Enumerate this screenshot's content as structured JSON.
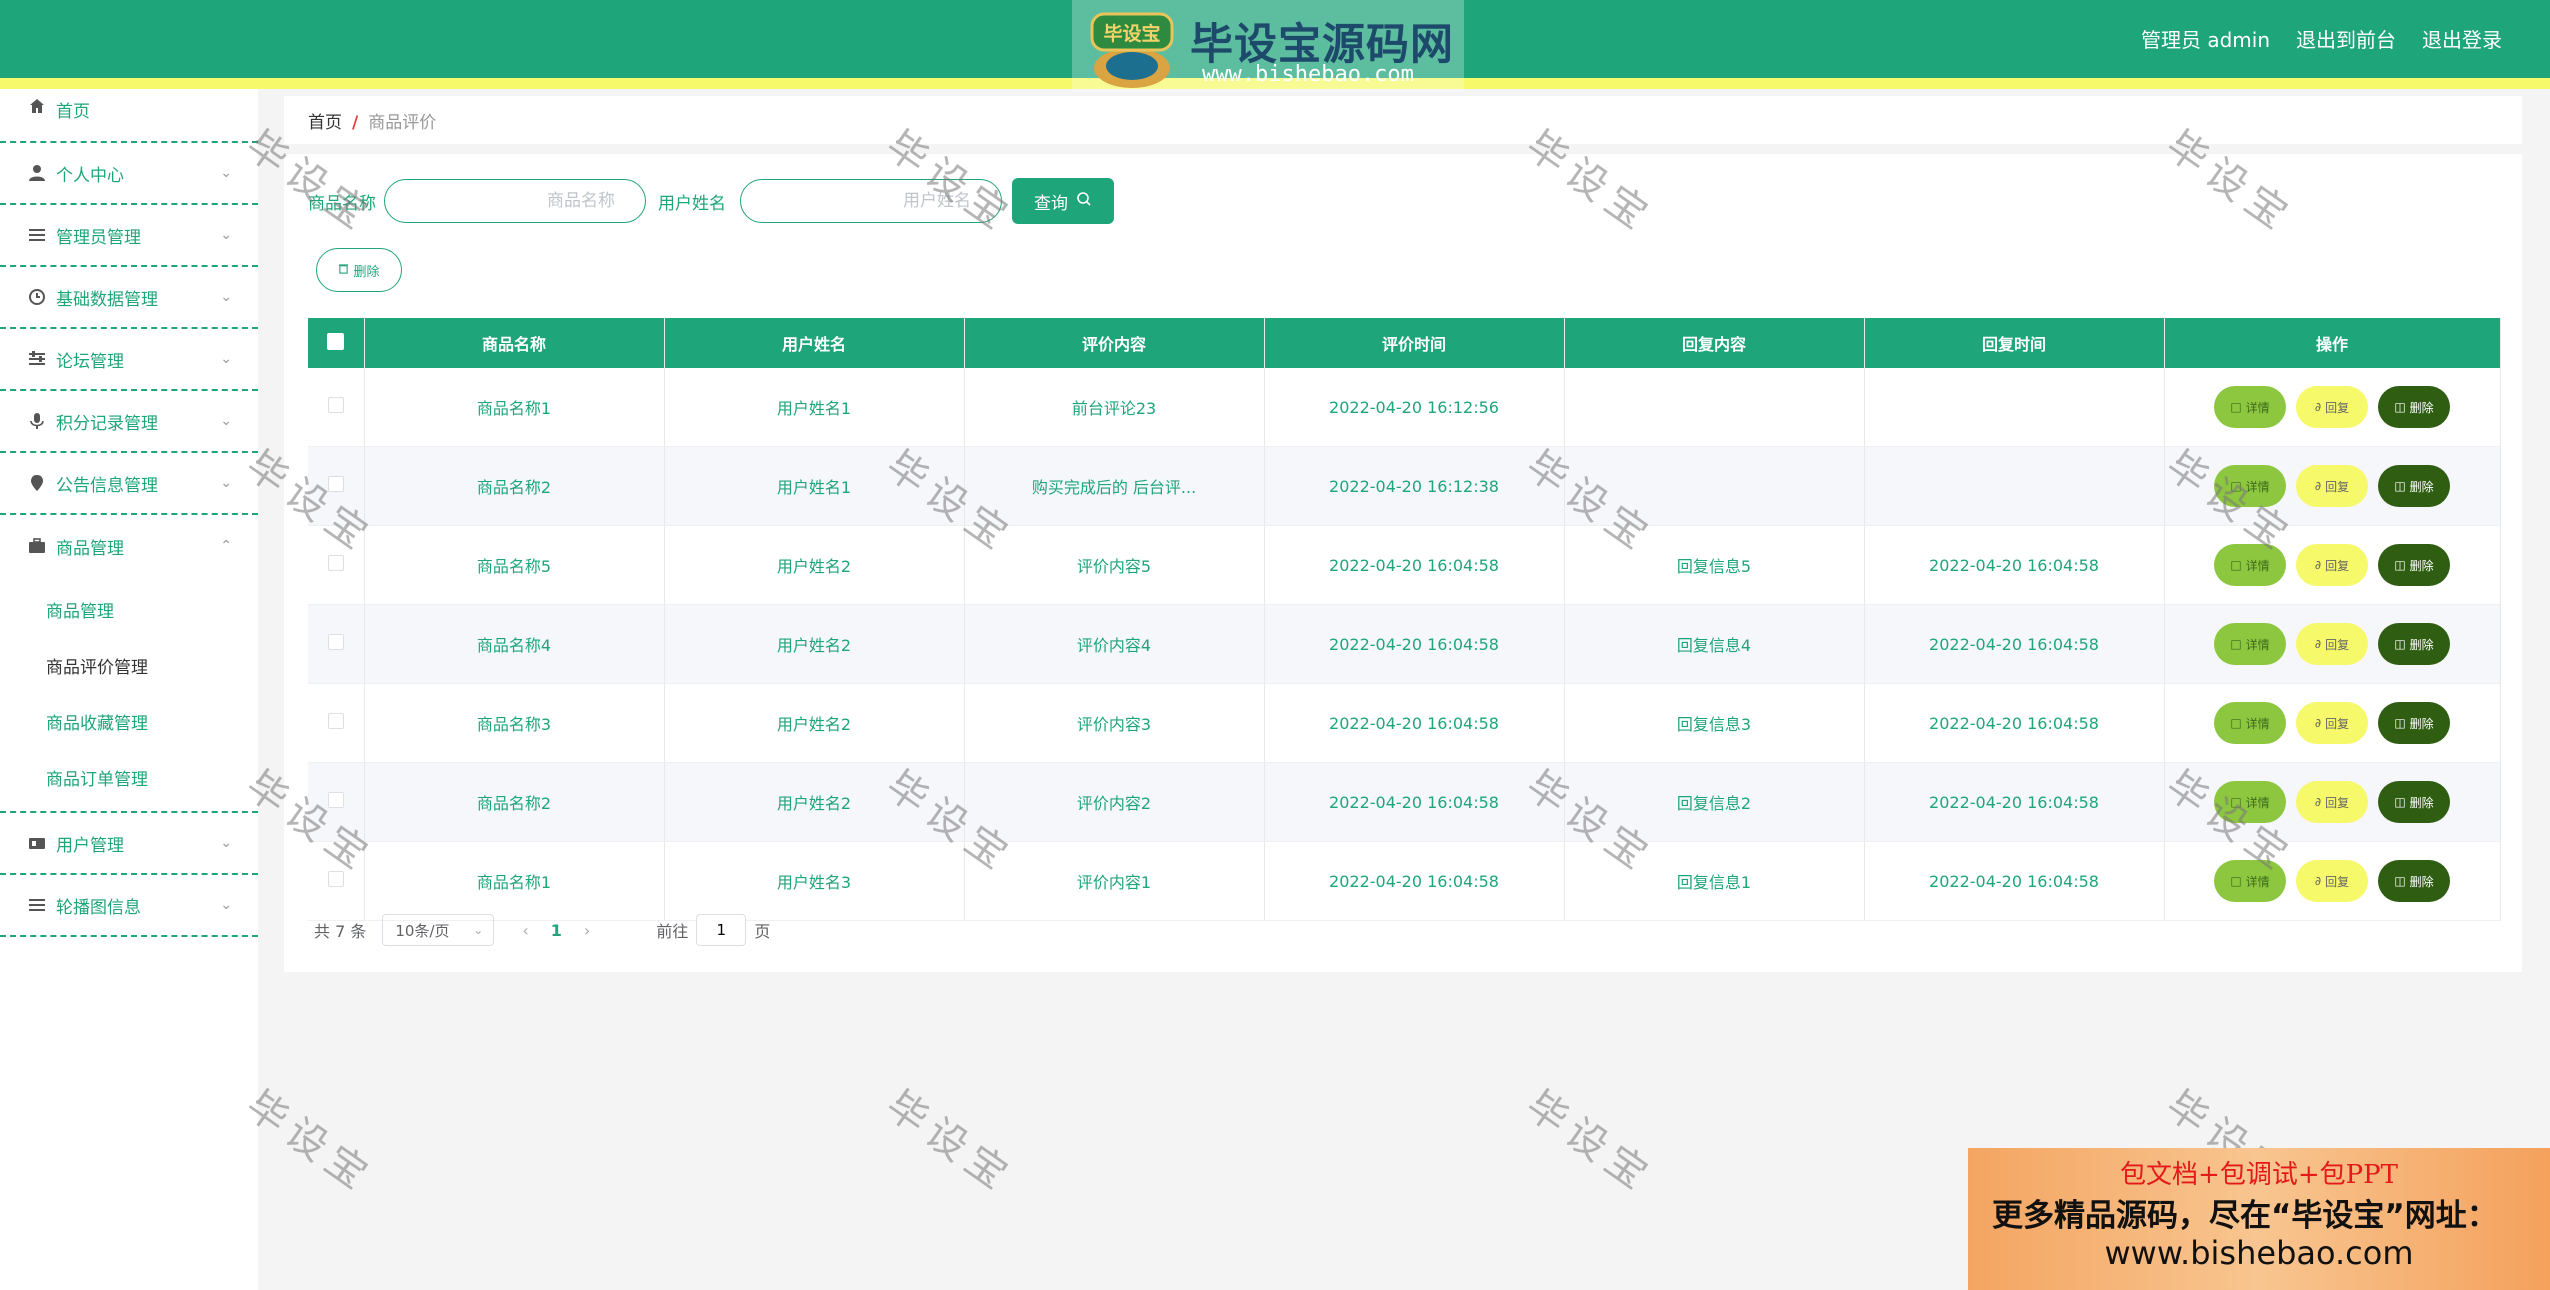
{
  "header": {
    "logo_badge": "毕设宝",
    "logo_title": "毕设宝源码网",
    "logo_url": "www.bishebao.com",
    "user_label": "管理员 admin",
    "front_link": "退出到前台",
    "logout_link": "退出登录"
  },
  "sidebar": {
    "items": [
      {
        "label": "首页",
        "icon": "home-icon"
      },
      {
        "label": "个人中心",
        "icon": "user-icon"
      },
      {
        "label": "管理员管理",
        "icon": "list-icon"
      },
      {
        "label": "基础数据管理",
        "icon": "clock-icon"
      },
      {
        "label": "论坛管理",
        "icon": "sliders-icon"
      },
      {
        "label": "积分记录管理",
        "icon": "mic-icon"
      },
      {
        "label": "公告信息管理",
        "icon": "pin-icon"
      },
      {
        "label": "商品管理",
        "icon": "briefcase-icon"
      },
      {
        "label": "用户管理",
        "icon": "id-card-icon"
      },
      {
        "label": "轮播图信息",
        "icon": "list-icon"
      }
    ],
    "sub_items": [
      "商品管理",
      "商品评价管理",
      "商品收藏管理",
      "商品订单管理"
    ]
  },
  "breadcrumb": {
    "home": "首页",
    "sep": "/",
    "current": "商品评价"
  },
  "search": {
    "goods_label": "商品名称",
    "goods_placeholder": "商品名称",
    "user_label": "用户姓名",
    "user_placeholder": "用户姓名",
    "query_label": "查询",
    "delete_label": "删除"
  },
  "table": {
    "columns": [
      "商品名称",
      "用户姓名",
      "评价内容",
      "评价时间",
      "回复内容",
      "回复时间",
      "操作"
    ],
    "rows": [
      {
        "goods": "商品名称1",
        "user": "用户姓名1",
        "content": "前台评论23",
        "time": "2022-04-20 16:12:56",
        "reply": "",
        "reply_time": ""
      },
      {
        "goods": "商品名称2",
        "user": "用户姓名1",
        "content": "购买完成后的 后台评...",
        "time": "2022-04-20 16:12:38",
        "reply": "",
        "reply_time": ""
      },
      {
        "goods": "商品名称5",
        "user": "用户姓名2",
        "content": "评价内容5",
        "time": "2022-04-20 16:04:58",
        "reply": "回复信息5",
        "reply_time": "2022-04-20 16:04:58"
      },
      {
        "goods": "商品名称4",
        "user": "用户姓名2",
        "content": "评价内容4",
        "time": "2022-04-20 16:04:58",
        "reply": "回复信息4",
        "reply_time": "2022-04-20 16:04:58"
      },
      {
        "goods": "商品名称3",
        "user": "用户姓名2",
        "content": "评价内容3",
        "time": "2022-04-20 16:04:58",
        "reply": "回复信息3",
        "reply_time": "2022-04-20 16:04:58"
      },
      {
        "goods": "商品名称2",
        "user": "用户姓名2",
        "content": "评价内容2",
        "time": "2022-04-20 16:04:58",
        "reply": "回复信息2",
        "reply_time": "2022-04-20 16:04:58"
      },
      {
        "goods": "商品名称1",
        "user": "用户姓名3",
        "content": "评价内容1",
        "time": "2022-04-20 16:04:58",
        "reply": "回复信息1",
        "reply_time": "2022-04-20 16:04:58"
      }
    ],
    "op_detail": "详情",
    "op_reply": "回复",
    "op_delete": "删除"
  },
  "pagination": {
    "total": "共 7 条",
    "page_size": "10条/页",
    "current_page": "1",
    "goto_label": "前往",
    "goto_value": "1",
    "page_suffix": "页"
  },
  "watermark": "毕设宝",
  "ad": {
    "line1": "包文档+包调试+包PPT",
    "line2": "更多精品源码，尽在“毕设宝”网址：",
    "line3": "www.bishebao.com"
  },
  "colors": {
    "primary": "#1fa57a",
    "accent_yellow": "#f6f96a",
    "detail_btn": "#8dc63f",
    "delete_btn": "#2f5e12"
  }
}
